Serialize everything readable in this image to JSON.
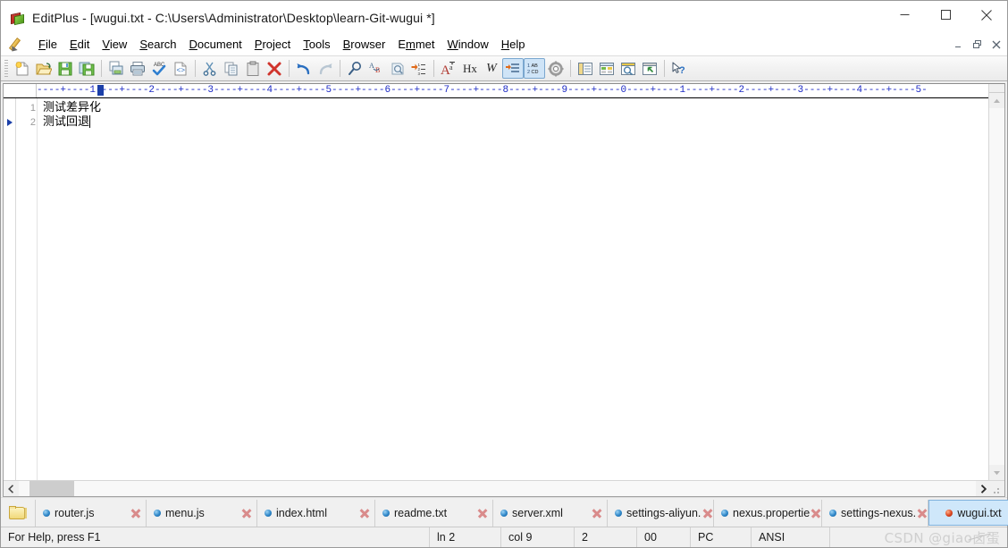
{
  "window": {
    "title": "EditPlus - [wugui.txt - C:\\Users\\Administrator\\Desktop\\learn-Git-wugui *]",
    "icon": "editplus-books-icon",
    "controls": {
      "minimize": "minimize-icon",
      "maximize": "maximize-icon",
      "close": "close-icon"
    },
    "mdi_controls": {
      "restore_down": "mdi-minimize-icon",
      "restore": "mdi-restore-icon",
      "close": "mdi-close-icon"
    }
  },
  "menu": {
    "pencil_icon": "pencil-icon",
    "items": [
      {
        "label": "File",
        "pre": "",
        "hot": "F",
        "post": "ile"
      },
      {
        "label": "Edit",
        "pre": "",
        "hot": "E",
        "post": "dit"
      },
      {
        "label": "View",
        "pre": "",
        "hot": "V",
        "post": "iew"
      },
      {
        "label": "Search",
        "pre": "",
        "hot": "S",
        "post": "earch"
      },
      {
        "label": "Document",
        "pre": "",
        "hot": "D",
        "post": "ocument"
      },
      {
        "label": "Project",
        "pre": "",
        "hot": "P",
        "post": "roject"
      },
      {
        "label": "Tools",
        "pre": "",
        "hot": "T",
        "post": "ools"
      },
      {
        "label": "Browser",
        "pre": "",
        "hot": "B",
        "post": "rowser"
      },
      {
        "label": "Emmet",
        "pre": "E",
        "hot": "m",
        "post": "met"
      },
      {
        "label": "Window",
        "pre": "",
        "hot": "W",
        "post": "indow"
      },
      {
        "label": "Help",
        "pre": "",
        "hot": "H",
        "post": "elp"
      }
    ]
  },
  "toolbar": {
    "groups": [
      {
        "buttons": [
          {
            "name": "new-file-icon",
            "tip": "New"
          },
          {
            "name": "open-file-icon",
            "tip": "Open"
          },
          {
            "name": "save-icon",
            "tip": "Save"
          },
          {
            "name": "save-all-icon",
            "tip": "Save All"
          }
        ]
      },
      {
        "buttons": [
          {
            "name": "print-preview-icon",
            "tip": "Print Preview"
          },
          {
            "name": "print-icon",
            "tip": "Print"
          },
          {
            "name": "spell-check-icon",
            "tip": "Spell Check"
          },
          {
            "name": "view-in-browser-icon",
            "tip": "View in Browser"
          }
        ]
      },
      {
        "buttons": [
          {
            "name": "cut-icon",
            "tip": "Cut"
          },
          {
            "name": "copy-icon",
            "tip": "Copy"
          },
          {
            "name": "paste-icon",
            "tip": "Paste"
          },
          {
            "name": "delete-icon",
            "tip": "Delete"
          }
        ]
      },
      {
        "buttons": [
          {
            "name": "undo-icon",
            "tip": "Undo"
          },
          {
            "name": "redo-icon",
            "tip": "Redo"
          }
        ]
      },
      {
        "buttons": [
          {
            "name": "find-icon",
            "tip": "Find"
          },
          {
            "name": "replace-icon",
            "tip": "Replace"
          },
          {
            "name": "find-in-files-icon",
            "tip": "Find in Files"
          },
          {
            "name": "goto-line-icon",
            "tip": "Go to Line"
          }
        ]
      },
      {
        "buttons": [
          {
            "name": "font-icon",
            "tip": "Font"
          },
          {
            "name": "hex-viewer-icon",
            "tip": "Hex Viewer",
            "text": "Hx"
          },
          {
            "name": "word-wrap-icon",
            "tip": "Word Wrap",
            "text": "W"
          },
          {
            "name": "show-spaces-icon",
            "tip": "Show Spaces",
            "active": false
          },
          {
            "name": "line-numbers-icon",
            "tip": "Line Numbers",
            "active": true,
            "text": "1 AB\n2 CD"
          },
          {
            "name": "preferences-icon",
            "tip": "Preferences"
          }
        ]
      },
      {
        "buttons": [
          {
            "name": "directory-window-icon",
            "tip": "Directory Window"
          },
          {
            "name": "document-selector-icon",
            "tip": "Document Selector"
          },
          {
            "name": "output-window-icon",
            "tip": "Output Window"
          },
          {
            "name": "fullscreen-icon",
            "tip": "Full Screen"
          }
        ]
      },
      {
        "buttons": [
          {
            "name": "context-help-icon",
            "tip": "Context Help"
          }
        ]
      }
    ]
  },
  "ruler": {
    "text": "----+----1----+----2----+----3----+----4----+----5----+----6----+----7----+----8----+----9----+----0----+----1----+----2----+----3----+----4----+----5-",
    "caret_marker": true
  },
  "editor": {
    "lines": [
      {
        "number": "1",
        "text": "测试差异化",
        "bookmark": false,
        "caret": false
      },
      {
        "number": "2",
        "text": "测试回退",
        "bookmark": true,
        "caret": true
      }
    ]
  },
  "tabs": {
    "folder_button": "folder-icon",
    "items": [
      {
        "label": "router.js",
        "active": false,
        "close": "close-tab-icon"
      },
      {
        "label": "menu.js",
        "active": false,
        "close": "close-tab-icon"
      },
      {
        "label": "index.html",
        "active": false,
        "close": "close-tab-icon"
      },
      {
        "label": "readme.txt",
        "active": false,
        "close": "close-tab-icon"
      },
      {
        "label": "server.xml",
        "active": false,
        "close": "close-tab-icon"
      },
      {
        "label": "settings-aliyun.",
        "active": false,
        "close": "close-tab-icon"
      },
      {
        "label": "nexus.propertie",
        "active": false,
        "close": "close-tab-icon"
      },
      {
        "label": "settings-nexus.",
        "active": false,
        "close": "close-tab-icon"
      },
      {
        "label": "wugui.txt",
        "active": true,
        "close": "close-tab-icon"
      }
    ]
  },
  "status_bar": {
    "help": "For Help, press F1",
    "line": "ln 2",
    "column": "col 9",
    "sel": "2",
    "hex": "00",
    "line_ending": "PC",
    "encoding": "ANSI",
    "watermark": "CSDN @giao卤蛋"
  },
  "colors": {
    "ruler_text": "#1b29c4",
    "active_tab_bg": "#cfe7fa",
    "active_tab_border": "#7fb2dd",
    "toolbar_active_bg": "#cfe4f7",
    "bookmark_marker": "#1b3fa8",
    "line_number_text": "#9a9a9a"
  }
}
